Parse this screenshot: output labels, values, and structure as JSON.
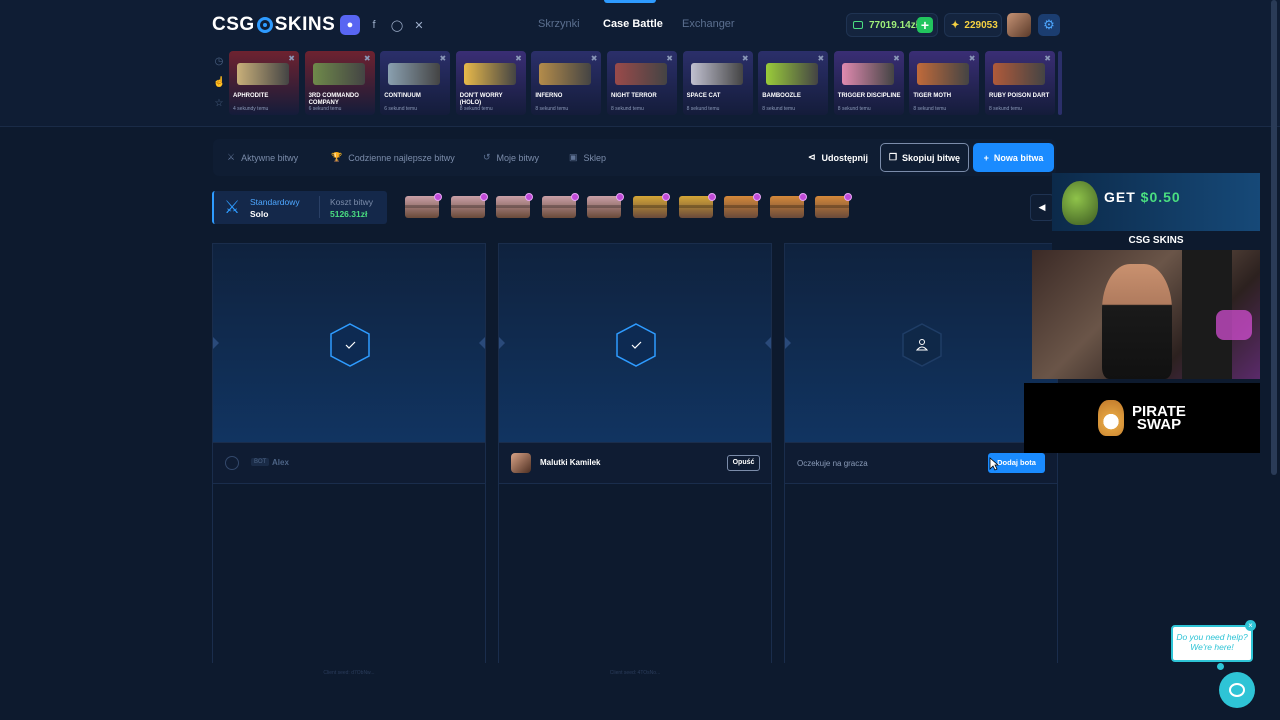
{
  "header": {
    "logo_left": "CSG",
    "logo_right": "SKINS",
    "nav": [
      "Skrzynki",
      "Case Battle",
      "Exchanger"
    ],
    "balance": "77019.14zł",
    "coins": "229053"
  },
  "drops": [
    {
      "name": "APHRODITE",
      "sub": "4 sekundy temu",
      "color": "#6e2230",
      "gun": "#c9b07a"
    },
    {
      "name": "3RD COMMANDO COMPANY",
      "sub": "6 sekund temu",
      "color": "#6e2230",
      "gun": "#6f8a4a"
    },
    {
      "name": "CONTINUUM",
      "sub": "6 sekund temu",
      "color": "#2b2f6a",
      "gun": "#8aa0b0"
    },
    {
      "name": "DON'T WORRY (HOLO)",
      "sub": "8 sekund temu",
      "color": "#3a2e75",
      "gun": "#e8b94a"
    },
    {
      "name": "INFERNO",
      "sub": "8 sekund temu",
      "color": "#2b2f6a",
      "gun": "#b48c4a"
    },
    {
      "name": "NIGHT TERROR",
      "sub": "8 sekund temu",
      "color": "#2b2f6a",
      "gun": "#9a4a4a"
    },
    {
      "name": "SPACE CAT",
      "sub": "8 sekund temu",
      "color": "#2b2f6a",
      "gun": "#c0c0d0"
    },
    {
      "name": "BAMBOOZLE",
      "sub": "8 sekund temu",
      "color": "#2b2f6a",
      "gun": "#9acc3a"
    },
    {
      "name": "TRIGGER DISCIPLINE",
      "sub": "8 sekund temu",
      "color": "#3a2e75",
      "gun": "#e08ab0"
    },
    {
      "name": "TIGER MOTH",
      "sub": "8 sekund temu",
      "color": "#3a2e75",
      "gun": "#c06a3a"
    },
    {
      "name": "RUBY POISON DART",
      "sub": "8 sekund temu",
      "color": "#3a2e75",
      "gun": "#b05a3a"
    }
  ],
  "tabs": [
    "Aktywne bitwy",
    "Codzienne najlepsze bitwy",
    "Moje bitwy",
    "Sklep"
  ],
  "actions": {
    "share": "Udostępnij",
    "copy": "Skopiuj bitwę",
    "new": "Nowa bitwa"
  },
  "battle": {
    "mode_type": "Standardowy",
    "mode_sub": "Solo",
    "cost_label": "Koszt bitwy",
    "cost_value": "5126.31zł"
  },
  "cases": [
    {
      "color": "#c9a0a8"
    },
    {
      "color": "#c9a0a8"
    },
    {
      "color": "#c9a0a8"
    },
    {
      "color": "#c9a0a8"
    },
    {
      "color": "#c9a0a8"
    },
    {
      "color": "#d4a637"
    },
    {
      "color": "#d4a637"
    },
    {
      "color": "#d4883a"
    },
    {
      "color": "#d4883a"
    },
    {
      "color": "#d4883a"
    }
  ],
  "players": [
    {
      "bot_badge": "BOT",
      "name": "Alex",
      "seed": "Client seed: d7ObNw..."
    },
    {
      "name": "Malutki Kamilek",
      "leave": "Opuść",
      "seed": "Client seed: 4TOsNo..."
    },
    {
      "waiting": "Oczekuje na gracza",
      "add_bot": "Dodaj bota"
    }
  ],
  "stream": {
    "ad_get": "GET",
    "ad_amount": "$0.50",
    "ad_brand": "CSG SKINS",
    "pirate_line1": "PIRATE",
    "pirate_line2": "SWAP"
  },
  "help": {
    "text": "Do you need help? We're here!"
  }
}
